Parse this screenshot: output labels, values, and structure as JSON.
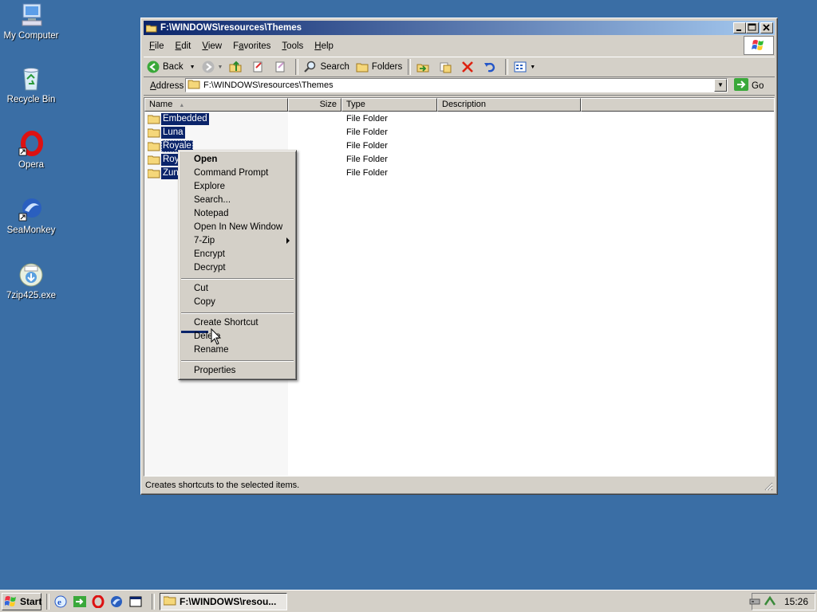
{
  "desktop": {
    "icons": [
      {
        "label": "My Computer",
        "icon": "my-computer-icon"
      },
      {
        "label": "Recycle Bin",
        "icon": "recycle-bin-icon"
      },
      {
        "label": "Opera",
        "icon": "opera-icon"
      },
      {
        "label": "SeaMonkey",
        "icon": "seamonkey-icon"
      },
      {
        "label": "7zip425.exe",
        "icon": "installer-icon"
      }
    ]
  },
  "window": {
    "title": "F:\\WINDOWS\\resources\\Themes",
    "controls": {
      "minimize": "_",
      "maximize": "□",
      "close": "×"
    }
  },
  "menubar": {
    "items": [
      {
        "hot": "F",
        "rest": "ile"
      },
      {
        "hot": "E",
        "rest": "dit"
      },
      {
        "hot": "V",
        "rest": "iew"
      },
      {
        "pre": "F",
        "hot": "a",
        "rest": "vorites"
      },
      {
        "hot": "T",
        "rest": "ools"
      },
      {
        "hot": "H",
        "rest": "elp"
      }
    ]
  },
  "toolbar": {
    "back": "Back",
    "search": "Search",
    "folders": "Folders"
  },
  "address": {
    "label_hot": "A",
    "label_rest": "ddress",
    "value": "F:\\WINDOWS\\resources\\Themes",
    "go": "Go"
  },
  "list": {
    "columns": [
      "Name",
      "Size",
      "Type",
      "Description"
    ],
    "rows": [
      {
        "name": "Embedded",
        "type": "File Folder"
      },
      {
        "name": "Luna",
        "type": "File Folder"
      },
      {
        "name": "Royale",
        "type": "File Folder"
      },
      {
        "name": "Roy",
        "type": "File Folder"
      },
      {
        "name": "Zun",
        "type": "File Folder"
      }
    ]
  },
  "context_menu": {
    "open": "Open",
    "command_prompt": "Command Prompt",
    "explore": "Explore",
    "search": "Search...",
    "notepad": "Notepad",
    "open_new_window": "Open In New Window",
    "sevenzip": "7-Zip",
    "encrypt": "Encrypt",
    "decrypt": "Decrypt",
    "cut": "Cut",
    "copy": "Copy",
    "create_shortcut": "Create Shortcut",
    "delete": "Delete",
    "rename": "Rename",
    "properties": "Properties"
  },
  "status": {
    "text": "Creates shortcuts to the selected items."
  },
  "taskbar": {
    "start": "Start",
    "task": "F:\\WINDOWS\\resou...",
    "clock": "15:26"
  },
  "colors": {
    "desktop": "#3a6ea5",
    "selection": "#0a246a",
    "face": "#d4d0c8"
  }
}
